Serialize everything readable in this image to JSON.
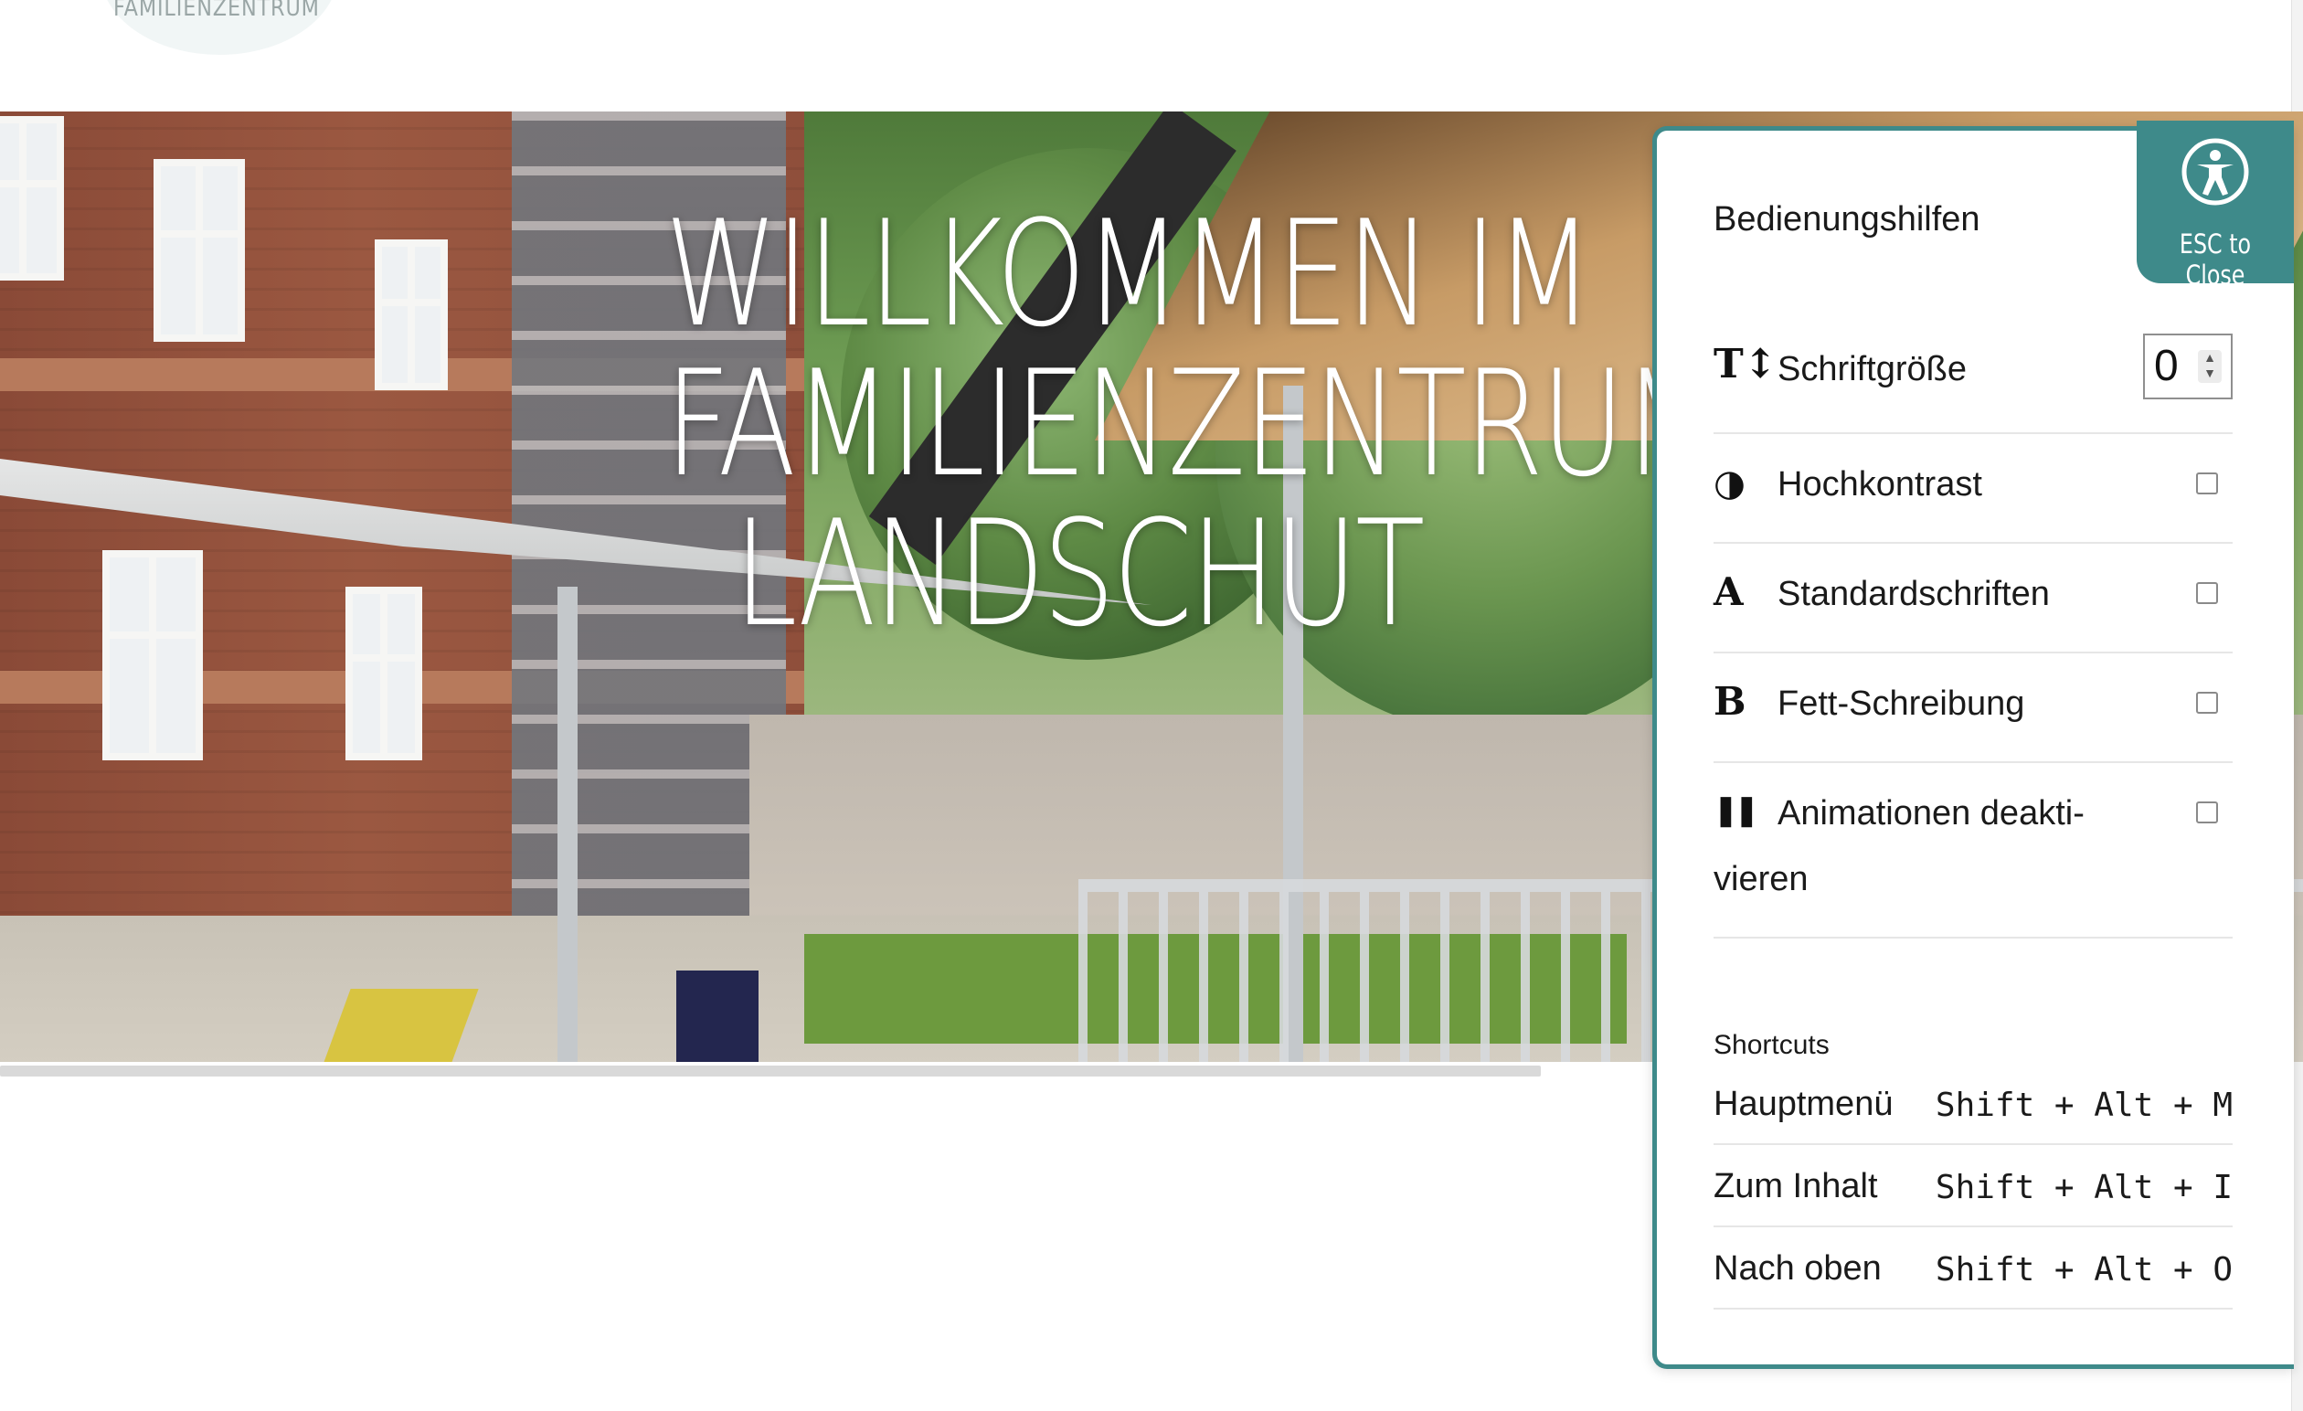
{
  "header": {
    "logo_text": "FAMILIENZENTRUM"
  },
  "hero": {
    "title_lines": [
      "WILLKOMMEN IM",
      "FAMILIENZENTRUM",
      "LANDSCHUT"
    ]
  },
  "accessibility_panel": {
    "title": "Bedienungshilfen",
    "close_label": "ESC to Close",
    "close_icon": "accessibility-icon",
    "options": [
      {
        "icon": "font-size-icon",
        "glyph": "T↕",
        "label": "Schriftgröße",
        "control": "number",
        "value": "0"
      },
      {
        "icon": "contrast-icon",
        "glyph": "◑",
        "label": "Hochkontrast",
        "control": "checkbox",
        "checked": false
      },
      {
        "icon": "standard-font-icon",
        "glyph": "A",
        "label": "Standardschriften",
        "control": "checkbox",
        "checked": false
      },
      {
        "icon": "bold-icon",
        "glyph": "B",
        "label": "Fett-Schreibung",
        "control": "checkbox",
        "checked": false
      },
      {
        "icon": "pause-icon",
        "glyph": "❚❚",
        "label_line1": "Animationen deakti-",
        "label_line2": "vieren",
        "control": "checkbox",
        "checked": false
      }
    ],
    "shortcuts": {
      "heading": "Shortcuts",
      "items": [
        {
          "label": "Hauptmenü",
          "keys": "Shift + Alt + M"
        },
        {
          "label": "Zum Inhalt",
          "keys": "Shift + Alt + I"
        },
        {
          "label": "Nach oben",
          "keys": "Shift + Alt + O"
        }
      ]
    }
  },
  "colors": {
    "accent": "#3e8a8a",
    "text": "#1a1a1a"
  }
}
